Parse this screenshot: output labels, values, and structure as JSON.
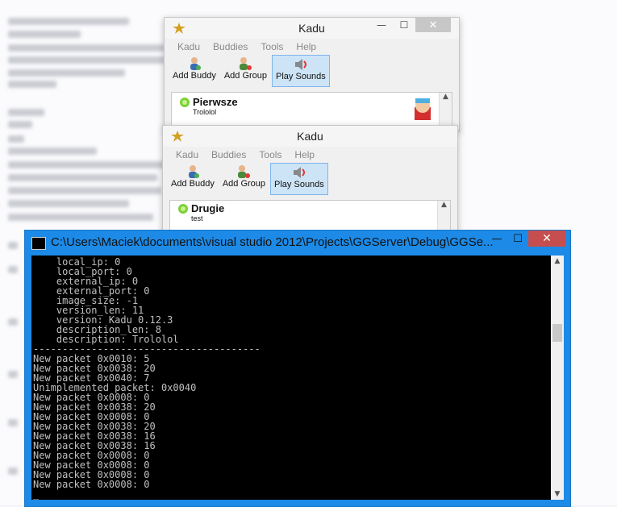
{
  "window1": {
    "title": "Kadu",
    "menu": [
      "Kadu",
      "Buddies",
      "Tools",
      "Help"
    ],
    "toolbar": [
      {
        "label": "Add Buddy",
        "icon": "add-buddy-icon",
        "active": false
      },
      {
        "label": "Add Group",
        "icon": "add-group-icon",
        "active": false
      },
      {
        "label": "Play Sounds",
        "icon": "speaker-icon",
        "active": true
      }
    ],
    "contact": {
      "name": "Pierwsze",
      "description": "Trololol"
    }
  },
  "window2": {
    "title": "Kadu",
    "menu": [
      "Kadu",
      "Buddies",
      "Tools",
      "Help"
    ],
    "toolbar": [
      {
        "label": "Add Buddy",
        "icon": "add-buddy-icon",
        "active": false
      },
      {
        "label": "Add Group",
        "icon": "add-group-icon",
        "active": false
      },
      {
        "label": "Play Sounds",
        "icon": "speaker-icon",
        "active": true
      }
    ],
    "contact": {
      "name": "Drugie",
      "description": "test"
    }
  },
  "console": {
    "title": "C:\\Users\\Maciek\\documents\\visual studio 2012\\Projects\\GGServer\\Debug\\GGSe...",
    "lines": [
      "    local_ip: 0",
      "    local_port: 0",
      "    external_ip: 0",
      "    external_port: 0",
      "    image_size: -1",
      "    version_len: 11",
      "    version: Kadu 0.12.3",
      "    description_len: 8",
      "    description: Trololol",
      "---------------------------------------",
      "New packet 0x0010: 5",
      "New packet 0x0038: 20",
      "New packet 0x0040: 7",
      "Unimplemented packet: 0x0040",
      "New packet 0x0008: 0",
      "New packet 0x0038: 20",
      "New packet 0x0008: 0",
      "New packet 0x0038: 20",
      "New packet 0x0038: 16",
      "New packet 0x0038: 16",
      "New packet 0x0008: 0",
      "New packet 0x0008: 0",
      "New packet 0x0008: 0",
      "New packet 0x0008: 0",
      "_"
    ]
  },
  "colors": {
    "console_bg": "#000000",
    "console_frame": "#1c8ae6",
    "close_red": "#c74e4e"
  }
}
